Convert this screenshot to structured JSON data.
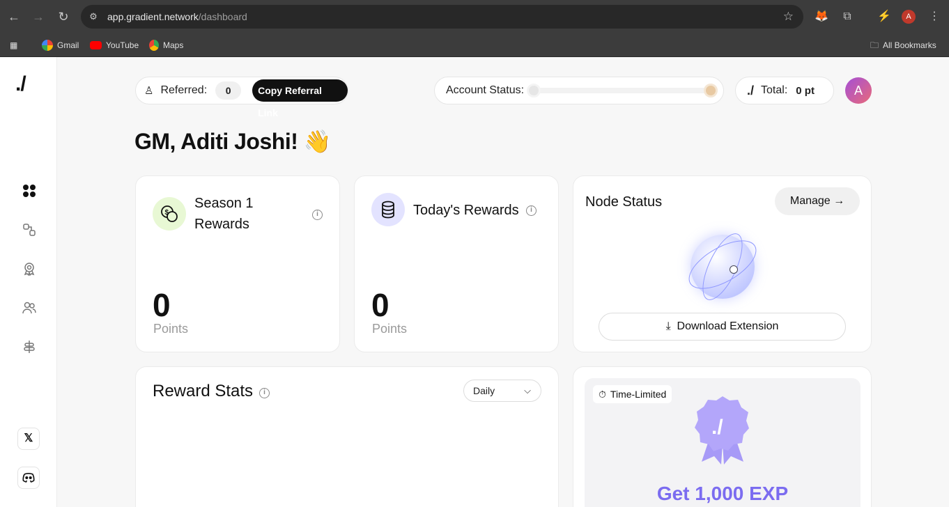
{
  "browser": {
    "url_host": "app.gradient.network",
    "url_path": "/dashboard",
    "profile_initial": "A",
    "bookmarks": [
      {
        "label": "Gmail"
      },
      {
        "label": "YouTube"
      },
      {
        "label": "Maps"
      }
    ],
    "all_bookmarks": "All Bookmarks"
  },
  "sidebar": {
    "logo": "./",
    "items": [
      {
        "icon": "dashboard-icon"
      },
      {
        "icon": "nodes-icon"
      },
      {
        "icon": "rewards-icon"
      },
      {
        "icon": "referral-icon"
      },
      {
        "icon": "settings-icon"
      }
    ],
    "social": {
      "x_label": "𝕏",
      "discord_label": "⌂"
    }
  },
  "topbar": {
    "referred_label": "Referred:",
    "referred_count": "0",
    "copy_button": "Copy Referral Link",
    "account_status_label": "Account Status:",
    "total_logo": "./",
    "total_label": "Total:",
    "total_value": "0 pt",
    "avatar_initial": "A"
  },
  "greeting": "GM, Aditi Joshi! 👋",
  "cards": {
    "season": {
      "title_line1": "Season 1",
      "title_line2": "Rewards",
      "value": "0",
      "unit": "Points"
    },
    "today": {
      "title": "Today's Rewards",
      "value": "0",
      "unit": "Points"
    },
    "node": {
      "title": "Node Status",
      "manage_label": "Manage",
      "download_label": "Download Extension"
    },
    "stats": {
      "title": "Reward Stats",
      "period": "Daily"
    },
    "promo": {
      "chip": "Time-Limited",
      "headline": "Get 1,000 EXP"
    }
  },
  "colors": {
    "accent": "#7b6cf0",
    "season_icon_bg": "#e8f8d4",
    "today_icon_bg": "#e3e3ff"
  }
}
